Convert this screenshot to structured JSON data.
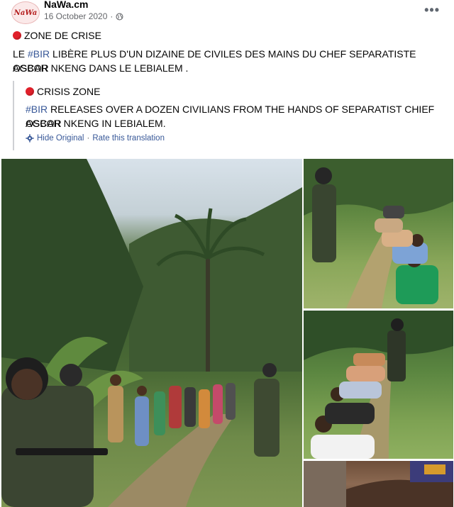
{
  "header": {
    "page_name": "NaWa.cm",
    "avatar_text": "NaWa",
    "date": "16 October 2020",
    "dot_separator": "·",
    "more_label": "•••"
  },
  "post": {
    "heading": "ZONE DE CRISE",
    "body_line1_prefix": "LE ",
    "hashtag": "#BIR",
    "body_line1_rest": " LIBÈRE PLUS D'UN DIZAINE DE CIVILES DES MAINS DU CHEF SEPARATISTE AGBOR",
    "body_line2": "OSCAR NKENG DANS LE LEBIALEM ."
  },
  "translation": {
    "heading": "CRISIS ZONE",
    "hashtag": "#BIR",
    "line1_rest": " RELEASES OVER A DOZEN CIVILIANS FROM THE HANDS OF SEPARATIST CHIEF AGBOR",
    "line2": "OSCAR NKENG IN LEBIALEM.",
    "hide_original": "Hide Original",
    "separator": " · ",
    "rate": "Rate this translation"
  },
  "colors": {
    "red_dot": "#e0202a",
    "link": "#385898",
    "text": "#050505",
    "secondary": "#65676b"
  },
  "icons": [
    "globe-icon",
    "gear-icon",
    "red-circle-icon",
    "more-options-icon"
  ]
}
